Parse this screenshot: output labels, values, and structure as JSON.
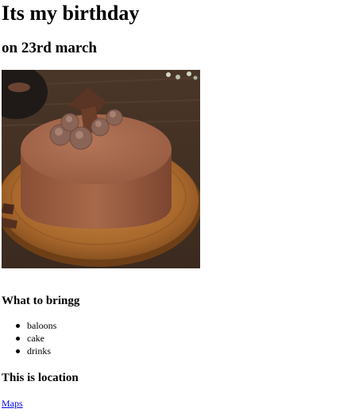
{
  "heading": {
    "title": "Its my birthday",
    "date": "on 23rd march"
  },
  "image": {
    "subject": "chocolate mousse cake on wooden board"
  },
  "bring": {
    "heading": "What to bringg",
    "items": [
      "baloons",
      "cake",
      "drinks"
    ]
  },
  "location": {
    "heading": "This is location",
    "link_label": "Maps",
    "link_color": "#0000ee"
  }
}
